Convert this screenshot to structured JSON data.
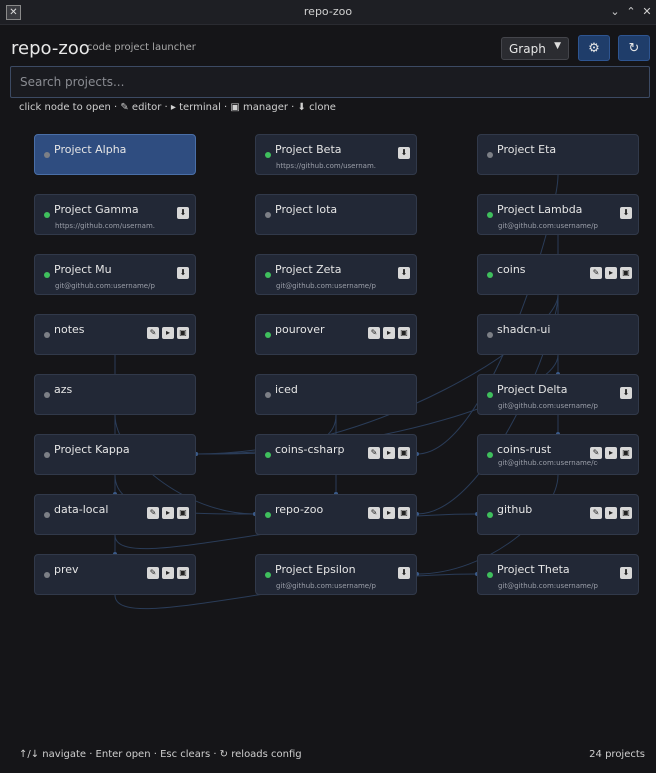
{
  "window": {
    "title": "repo-zoo",
    "icon": "x-app-icon"
  },
  "header": {
    "title": "repo-zoo",
    "subtitle": "code project launcher",
    "view_mode": "Graph",
    "settings_icon": "gear-icon",
    "reload_icon": "reload-icon"
  },
  "search": {
    "placeholder": "Search projects..."
  },
  "hint": "click node to open · ✎ editor · ▸ terminal · ▣ manager · ⬇ clone",
  "footer": {
    "hint": "↑/↓ navigate · Enter open · Esc clears · ↻ reloads config",
    "count": "24 projects"
  },
  "colors": {
    "accent": "#2f4d80",
    "status_on": "#3fbf5d",
    "status_off": "#7c7f86",
    "node_bg": "#222836"
  },
  "nodes": [
    {
      "name": "Project Alpha",
      "url": "",
      "status": "off",
      "actions": "none",
      "selected": true
    },
    {
      "name": "Project Beta",
      "url": "https://github.com/usernam...",
      "status": "on",
      "actions": "clone"
    },
    {
      "name": "Project Eta",
      "url": "",
      "status": "off",
      "actions": "none"
    },
    {
      "name": "Project Gamma",
      "url": "https://github.com/usernam...",
      "status": "on",
      "actions": "clone"
    },
    {
      "name": "Project Iota",
      "url": "",
      "status": "off",
      "actions": "none"
    },
    {
      "name": "Project Lambda",
      "url": "git@github.com:username/pr...",
      "status": "on",
      "actions": "clone"
    },
    {
      "name": "Project Mu",
      "url": "git@github.com:username/pr...",
      "status": "on",
      "actions": "clone"
    },
    {
      "name": "Project Zeta",
      "url": "git@github.com:username/pr...",
      "status": "on",
      "actions": "clone"
    },
    {
      "name": "coins",
      "url": "",
      "status": "on",
      "actions": "local"
    },
    {
      "name": "notes",
      "url": "",
      "status": "off",
      "actions": "local"
    },
    {
      "name": "pourover",
      "url": "",
      "status": "on",
      "actions": "local"
    },
    {
      "name": "shadcn-ui",
      "url": "",
      "status": "off",
      "actions": "none"
    },
    {
      "name": "azs",
      "url": "",
      "status": "off",
      "actions": "none"
    },
    {
      "name": "iced",
      "url": "",
      "status": "off",
      "actions": "none"
    },
    {
      "name": "Project Delta",
      "url": "git@github.com:username/pr...",
      "status": "on",
      "actions": "clone"
    },
    {
      "name": "Project Kappa",
      "url": "",
      "status": "off",
      "actions": "none"
    },
    {
      "name": "coins-csharp",
      "url": "",
      "status": "on",
      "actions": "local"
    },
    {
      "name": "coins-rust",
      "url": "git@github.com:username/co...",
      "status": "on",
      "actions": "local"
    },
    {
      "name": "data-local",
      "url": "",
      "status": "off",
      "actions": "local"
    },
    {
      "name": "repo-zoo",
      "url": "",
      "status": "on",
      "actions": "local"
    },
    {
      "name": "github",
      "url": "",
      "status": "on",
      "actions": "local"
    },
    {
      "name": "prev",
      "url": "",
      "status": "off",
      "actions": "local"
    },
    {
      "name": "Project Epsilon",
      "url": "git@github.com:username/pr...",
      "status": "on",
      "actions": "clone"
    },
    {
      "name": "Project Theta",
      "url": "git@github.com:username/pr...",
      "status": "on",
      "actions": "clone"
    }
  ]
}
